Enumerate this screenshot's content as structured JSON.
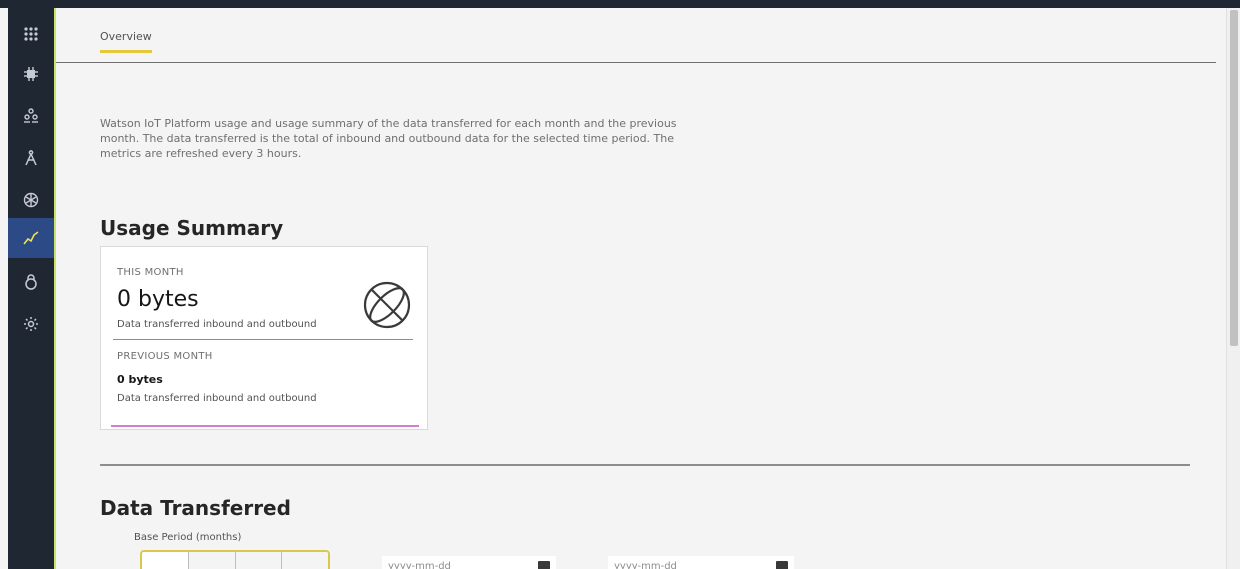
{
  "sidebar": {
    "items": [
      {
        "icon": "app-grid-icon",
        "active": false
      },
      {
        "icon": "chip-icon",
        "active": false
      },
      {
        "icon": "devices-icon",
        "active": false
      },
      {
        "icon": "compass-icon",
        "active": false
      },
      {
        "icon": "network-icon",
        "active": false
      },
      {
        "icon": "usage-chart-icon",
        "active": true
      },
      {
        "icon": "security-lock-icon",
        "active": false
      },
      {
        "icon": "settings-gear-icon",
        "active": false
      }
    ]
  },
  "tabs": {
    "overview": "Overview"
  },
  "description": "Watson IoT Platform usage and usage summary of the data transferred for each month and the previous month. The data transferred is the total of inbound and outbound data for the selected time period. The metrics are refreshed every 3 hours.",
  "usage_summary": {
    "title": "Usage Summary",
    "this_month_label": "THIS MONTH",
    "this_month_value": "0 bytes",
    "this_month_sub": "Data transferred inbound and outbound",
    "previous_month_label": "PREVIOUS MONTH",
    "previous_month_value": "0 bytes",
    "previous_month_sub": "Data transferred inbound and outbound"
  },
  "data_transferred": {
    "title": "Data Transferred",
    "base_period_label": "Base Period (months)",
    "start_date_placeholder": "yyyy-mm-dd",
    "end_date_placeholder": "yyyy-mm-dd"
  },
  "colors": {
    "sidebar_bg": "#1f2733",
    "active_nav": "#2c4a86",
    "accent": "#e6c93a"
  }
}
